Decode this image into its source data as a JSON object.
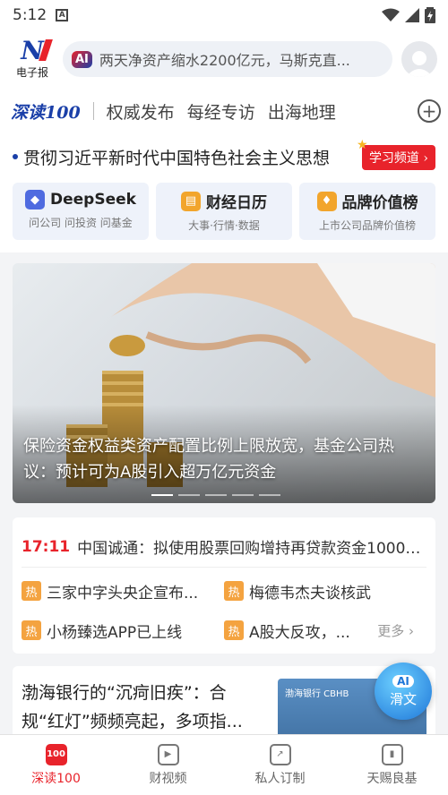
{
  "status_bar": {
    "time": "5:12",
    "notice_icon": "a-letter-icon",
    "battery": "charging"
  },
  "header": {
    "logo_text": "电子报",
    "search_ai_badge": "AI",
    "search_query": "两天净资产缩水2200亿元，马斯克直...",
    "avatar_icon": "user-avatar-icon"
  },
  "tabs": {
    "brand": "深读100",
    "items": [
      "权威发布",
      "每经专访",
      "出海地理"
    ],
    "add_icon": "plus-circle-icon"
  },
  "ticker": {
    "text": "贯彻习近平新时代中国特色社会主义思想",
    "badge": "学习频道 ›"
  },
  "quick_cards": [
    {
      "title": "DeepSeek",
      "sub": "问公司 问投资 问基金",
      "icon": "whale-icon",
      "color": "#4f6be0"
    },
    {
      "title": "财经日历",
      "sub": "大事·行情·数据",
      "icon": "calendar-icon",
      "color": "#f2a52c"
    },
    {
      "title": "品牌价值榜",
      "sub": "上市公司品牌价值榜",
      "icon": "diamond-icon",
      "color": "#f2a52c"
    }
  ],
  "banner": {
    "caption": "保险资金权益类资产配置比例上限放宽，基金公司热议：预计可为A股引入超万亿元资金",
    "active_dot": 0
  },
  "flash": {
    "time": "17:11",
    "text": "中国诚通：拟使用股票回购增持再贷款资金1000亿..."
  },
  "hot": {
    "tag": "热",
    "items": [
      "三家中字头央企宣布...",
      "梅德韦杰夫谈核武",
      "小杨臻选APP已上线",
      "A股大反攻，..."
    ],
    "more": "更多"
  },
  "article": {
    "headline": "渤海银行的“沉疴旧疾”：合规“红灯”频频亮起，多项指...",
    "thumb_sign": "渤海银行 CBHB"
  },
  "ai_button": {
    "badge": "AI",
    "label": "滑文"
  },
  "bottom_nav": [
    {
      "label": "深读100",
      "icon": "deep-read-icon",
      "active": true
    },
    {
      "label": "财视频",
      "icon": "play-icon",
      "active": false
    },
    {
      "label": "私人订制",
      "icon": "trend-icon",
      "active": false
    },
    {
      "label": "天赐良基",
      "icon": "bar-chart-icon",
      "active": false
    }
  ],
  "colors": {
    "brand_blue": "#1a3fa8",
    "brand_red": "#e8232b",
    "hot_orange": "#f4a340"
  }
}
